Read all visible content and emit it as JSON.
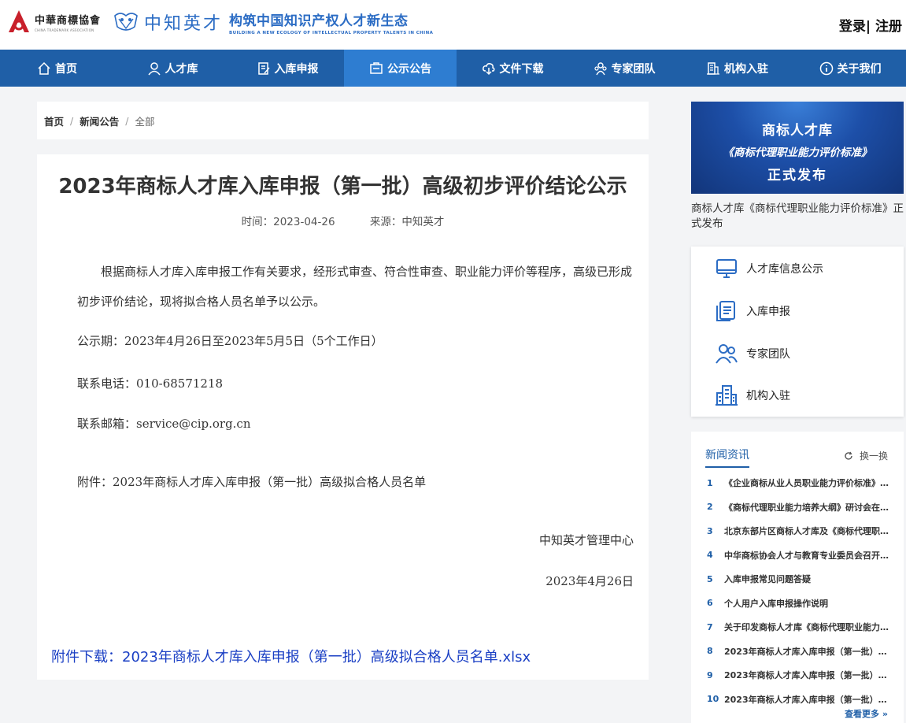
{
  "header": {
    "cta_name": "中華商標協會",
    "cta_en": "CHINA TRADEMARK ASSOCIATION",
    "brand": "中知英才",
    "slogan": "构筑中国知识产权人才新生态",
    "slogan_en": "BUILDING A NEW ECOLOGY OF INTELLECTUAL PROPERTY TALENTS IN CHINA",
    "login": "登录",
    "separator": "|",
    "register": "注册"
  },
  "nav": [
    {
      "label": "首页",
      "icon": "home-icon"
    },
    {
      "label": "人才库",
      "icon": "user-icon"
    },
    {
      "label": "入库申报",
      "icon": "form-icon"
    },
    {
      "label": "公示公告",
      "icon": "notice-icon"
    },
    {
      "label": "文件下载",
      "icon": "cloud-download-icon"
    },
    {
      "label": "专家团队",
      "icon": "team-icon"
    },
    {
      "label": "机构入驻",
      "icon": "building-icon"
    },
    {
      "label": "关于我们",
      "icon": "info-icon"
    }
  ],
  "breadcrumb": {
    "home": "首页",
    "section": "新闻公告",
    "current": "全部",
    "sep": "/"
  },
  "article": {
    "title": "2023年商标人才库入库申报（第一批）高级初步评价结论公示",
    "time_label": "时间：2023-04-26",
    "source_label": "来源：中知英才",
    "para1": "根据商标人才库入库申报工作有关要求，经形式审查、符合性审查、职业能力评价等程序，高级已形成初步评价结论，现将拟合格人员名单予以公示。",
    "period": "公示期：2023年4月26日至2023年5月5日（5个工作日）",
    "phone": "联系电话：010-68571218",
    "email": "联系邮箱：service@cip.org.cn",
    "attachment": "附件：2023年商标人才库入库申报（第一批）高级拟合格人员名单",
    "signature": "中知英才管理中心",
    "date": "2023年4月26日",
    "download": "附件下载：2023年商标人才库入库申报（第一批）高级拟合格人员名单.xlsx"
  },
  "banner": {
    "line1": "商标人才库",
    "line2": "《商标代理职业能力评价标准》",
    "line3": "正式发布",
    "caption": "商标人才库《商标代理职业能力评价标准》正式发布"
  },
  "quick_links": [
    {
      "label": "人才库信息公示",
      "icon": "monitor-icon"
    },
    {
      "label": "入库申报",
      "icon": "document-icon"
    },
    {
      "label": "专家团队",
      "icon": "team-icon"
    },
    {
      "label": "机构入驻",
      "icon": "building-icon"
    }
  ],
  "news": {
    "tab": "新闻资讯",
    "refresh": "换一换",
    "more": "查看更多 »",
    "items": [
      {
        "num": "1",
        "title": "《企业商标从业人员职业能力评价标准》..."
      },
      {
        "num": "2",
        "title": "《商标代理职业能力培养大纲》研讨会在..."
      },
      {
        "num": "3",
        "title": "北京东部片区商标人才库及《商标代理职..."
      },
      {
        "num": "4",
        "title": "中华商标协会人才与教育专业委员会召开..."
      },
      {
        "num": "5",
        "title": "入库申报常见问题答疑"
      },
      {
        "num": "6",
        "title": "个人用户入库申报操作说明"
      },
      {
        "num": "7",
        "title": "关于印发商标人才库《商标代理职业能力..."
      },
      {
        "num": "8",
        "title": "2023年商标人才库入库申报（第一批）高..."
      },
      {
        "num": "9",
        "title": "2023年商标人才库入库申报（第一批）二..."
      },
      {
        "num": "10",
        "title": "2023年商标人才库入库申报（第一批）二..."
      }
    ]
  },
  "colors": {
    "nav": "#1f5fa7",
    "nav_active": "#2e7dd1",
    "brand_blue": "#2b6cc4",
    "link": "#1a3fc4"
  }
}
